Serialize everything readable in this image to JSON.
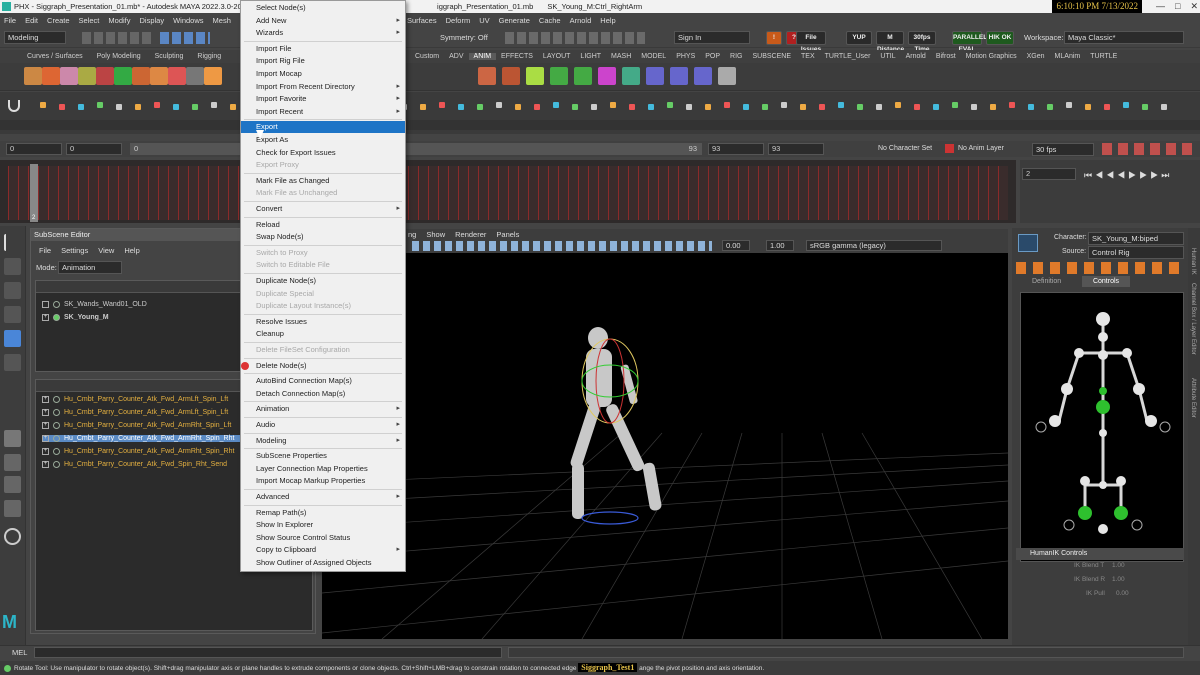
{
  "title": {
    "app_tab": "PHX - Siggraph_Presentation_01.mb* - Autodesk MAYA 2022.3.0-20...",
    "tab2": "iggraph_Presentation_01.mb",
    "tab3": "SK_Young_M:Ctrl_RightArm",
    "clock": "6:10:10 PM 7/13/2022"
  },
  "menubar": [
    "File",
    "Edit",
    "Create",
    "Select",
    "Modify",
    "Display",
    "Windows",
    "Mesh"
  ],
  "menubar_right": [
    "Surfaces",
    "Deform",
    "UV",
    "Generate",
    "Cache",
    "Arnold",
    "Help"
  ],
  "status": {
    "mode": "Modeling",
    "symmetry": "Symmetry: Off",
    "sign_in": "Sign In",
    "workspace_label": "Workspace:",
    "workspace": "Maya Classic*"
  },
  "status_buttons": [
    "File Issues",
    "YUP",
    "M Distance",
    "30fps Time",
    "PARALLEL EVAL",
    "HIK OK"
  ],
  "shelf_tabs_left": [
    "Curves / Surfaces",
    "Poly Modeling",
    "Sculpting",
    "Rigging"
  ],
  "shelf_tabs_right": [
    "Custom",
    "ADV",
    "ANIM",
    "EFFECTS",
    "LAYOUT",
    "LIGHT",
    "MASH",
    "MODEL",
    "PHYS",
    "POP",
    "RIG",
    "SUBSCENE",
    "TEX",
    "TURTLE_User",
    "UTIL",
    "Arnold",
    "Bifrost",
    "Motion Graphics",
    "XGen",
    "MLAnim",
    "TURTLE"
  ],
  "shelf_selected": "ANIM",
  "time": {
    "start": "0",
    "start2": "0",
    "range_start": "0",
    "range_end": "93",
    "end": "93",
    "end2": "93",
    "char_set": "No Character Set",
    "anim_layer": "No Anim Layer",
    "fps": "30 fps",
    "current_frame": "2",
    "playhead": "2"
  },
  "subscene": {
    "title": "SubScene Editor",
    "menu": [
      "File",
      "Settings",
      "View",
      "Help"
    ],
    "mode_label": "Mode:",
    "mode": "Animation",
    "nodes": [
      "SK_Wands_Wand01_OLD",
      "SK_Young_M"
    ],
    "clips": [
      "Hu_Cmbt_Parry_Counter_Atk_Fwd_ArmLft_Spin_Lft",
      "Hu_Cmbt_Parry_Counter_Atk_Fwd_ArmLft_Spin_Lft",
      "Hu_Cmbt_Parry_Counter_Atk_Fwd_ArmRht_Spin_Lft",
      "Hu_Cmbt_Parry_Counter_Atk_Fwd_ArmRht_Spin_Rht",
      "Hu_Cmbt_Parry_Counter_Atk_Fwd_ArmRht_Spin_Rht",
      "Hu_Cmbt_Parry_Counter_Atk_Fwd_Spin_Rht_Send"
    ],
    "selected_clip": 3
  },
  "context_menu": [
    {
      "label": "Select Node(s)",
      "state": "normal"
    },
    {
      "label": "Add New",
      "state": "normal",
      "sub": true
    },
    {
      "label": "Wizards",
      "state": "normal",
      "sub": true
    },
    {
      "sep": true
    },
    {
      "label": "Import File",
      "state": "normal"
    },
    {
      "label": "Import Rig File",
      "state": "normal"
    },
    {
      "label": "Import Mocap",
      "state": "normal"
    },
    {
      "label": "Import From Recent Directory",
      "state": "normal",
      "sub": true
    },
    {
      "label": "Import Favorite",
      "state": "normal",
      "sub": true
    },
    {
      "label": "Import Recent",
      "state": "normal",
      "sub": true
    },
    {
      "sep": true
    },
    {
      "label": "Export",
      "state": "highlight"
    },
    {
      "label": "Export As",
      "state": "normal"
    },
    {
      "label": "Check for Export Issues",
      "state": "normal"
    },
    {
      "label": "Export Proxy",
      "state": "disabled"
    },
    {
      "sep": true
    },
    {
      "label": "Mark File as Changed",
      "state": "normal"
    },
    {
      "label": "Mark File as Unchanged",
      "state": "disabled"
    },
    {
      "sep": true
    },
    {
      "label": "Convert",
      "state": "normal",
      "sub": true
    },
    {
      "sep": true
    },
    {
      "label": "Reload",
      "state": "normal"
    },
    {
      "label": "Swap Node(s)",
      "state": "normal"
    },
    {
      "sep": true
    },
    {
      "label": "Switch to Proxy",
      "state": "disabled"
    },
    {
      "label": "Switch to Editable File",
      "state": "disabled"
    },
    {
      "sep": true
    },
    {
      "label": "Duplicate Node(s)",
      "state": "normal"
    },
    {
      "label": "Duplicate Special",
      "state": "disabled"
    },
    {
      "label": "Duplicate Layout Instance(s)",
      "state": "disabled"
    },
    {
      "sep": true
    },
    {
      "label": "Resolve Issues",
      "state": "normal"
    },
    {
      "label": "Cleanup",
      "state": "normal"
    },
    {
      "sep": true
    },
    {
      "label": "Delete FileSet Configuration",
      "state": "disabled"
    },
    {
      "sep": true
    },
    {
      "label": "Delete Node(s)",
      "state": "normal"
    },
    {
      "sep": true
    },
    {
      "label": "AutoBind Connection Map(s)",
      "state": "normal"
    },
    {
      "label": "Detach Connection Map(s)",
      "state": "normal"
    },
    {
      "sep": true
    },
    {
      "label": "Animation",
      "state": "normal",
      "sub": true
    },
    {
      "sep": true
    },
    {
      "label": "Audio",
      "state": "normal",
      "sub": true
    },
    {
      "sep": true
    },
    {
      "label": "Modeling",
      "state": "normal",
      "sub": true
    },
    {
      "sep": true
    },
    {
      "label": "SubScene Properties",
      "state": "normal"
    },
    {
      "label": "Layer Connection Map Properties",
      "state": "normal"
    },
    {
      "label": "Import Mocap Markup Properties",
      "state": "normal"
    },
    {
      "sep": true
    },
    {
      "label": "Advanced",
      "state": "normal",
      "sub": true
    },
    {
      "sep": true
    },
    {
      "label": "Remap Path(s)",
      "state": "normal"
    },
    {
      "label": "Show In Explorer",
      "state": "normal"
    },
    {
      "label": "Show Source Control Status",
      "state": "normal"
    },
    {
      "label": "Copy to Clipboard",
      "state": "normal",
      "sub": true
    },
    {
      "label": "Show Outliner of Assigned Objects",
      "state": "normal"
    }
  ],
  "viewport": {
    "menu": [
      "ng",
      "Show",
      "Renderer",
      "Panels"
    ],
    "val1": "0.00",
    "val2": "1.00",
    "colorspace": "sRGB gamma (legacy)"
  },
  "hik": {
    "character_label": "Character:",
    "character": "SK_Young_M:biped",
    "source_label": "Source:",
    "source": "Control Rig",
    "tabs": [
      "Definition",
      "Controls"
    ],
    "controls_title": "HumanIK Controls",
    "ik_blend_t": "IK Blend T",
    "ik_blend_t_val": "1.00",
    "ik_blend_r": "IK Blend R",
    "ik_blend_r_val": "1.00",
    "ik_pull": "IK Pull",
    "ik_pull_val": "0.00",
    "side_tabs": [
      "Human IK",
      "Channel Box / Layer Editor",
      "Attribute Editor"
    ]
  },
  "mel_label": "MEL",
  "help_text": "Rotate Tool: Use manipulator to rotate object(s). Shift+drag manipulator axis or plane handles to extrude components or clone objects. Ctrl+Shift+LMB+drag to constrain rotation to connected edge",
  "help_text2": "ange the pivot position and axis orientation.",
  "watermark": "Siggraph_Test1"
}
